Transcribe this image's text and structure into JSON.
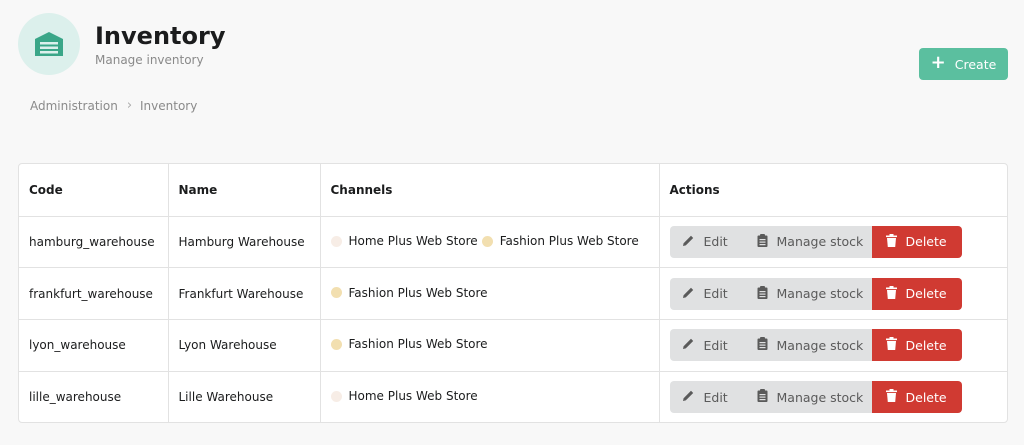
{
  "header": {
    "title": "Inventory",
    "subtitle": "Manage inventory",
    "icon": "warehouse-icon"
  },
  "toolbar": {
    "create_label": "Create"
  },
  "breadcrumb": {
    "items": [
      "Administration",
      "Inventory"
    ]
  },
  "table": {
    "columns": [
      "Code",
      "Name",
      "Channels",
      "Actions"
    ],
    "rows": [
      {
        "code": "hamburg_warehouse",
        "name": "Hamburg Warehouse",
        "channels": [
          "Home Plus Web Store",
          "Fashion Plus Web Store"
        ]
      },
      {
        "code": "frankfurt_warehouse",
        "name": "Frankfurt Warehouse",
        "channels": [
          "Fashion Plus Web Store"
        ]
      },
      {
        "code": "lyon_warehouse",
        "name": "Lyon Warehouse",
        "channels": [
          "Fashion Plus Web Store"
        ]
      },
      {
        "code": "lille_warehouse",
        "name": "Lille Warehouse",
        "channels": [
          "Home Plus Web Store"
        ]
      }
    ],
    "actions": {
      "edit": "Edit",
      "manage_stock": "Manage stock",
      "delete": "Delete"
    }
  },
  "colors": {
    "accent": "#5bbf9f",
    "danger": "#d03a32",
    "home_plus_dot": "#f7ede6",
    "fashion_plus_dot": "#f2dfb0"
  }
}
